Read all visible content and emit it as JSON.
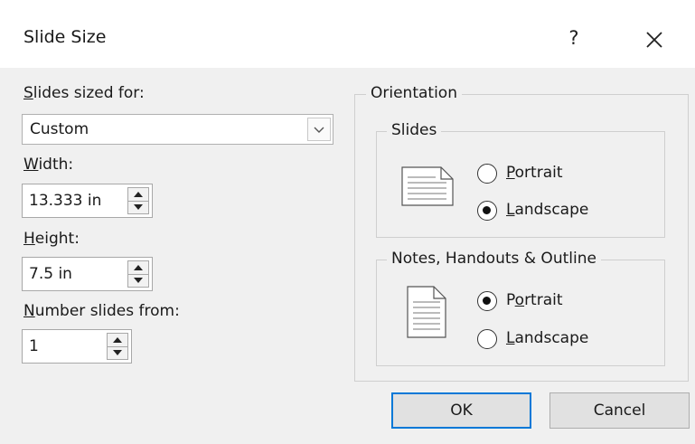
{
  "dialog": {
    "title": "Slide Size",
    "help": "?",
    "close_icon": "close-icon"
  },
  "left": {
    "sized_for_pre": "S",
    "sized_for_rest": "lides sized for:",
    "sized_for_value": "Custom",
    "width_pre": "W",
    "width_rest": "idth:",
    "width_value": "13.333 in",
    "height_pre": "H",
    "height_rest": "eight:",
    "height_value": "7.5 in",
    "number_pre": "N",
    "number_rest": "umber slides from:",
    "number_value": "1"
  },
  "orientation": {
    "title": "Orientation",
    "slides": {
      "title": "Slides",
      "portrait_pre": "",
      "portrait_ul": "P",
      "portrait_post": "ortrait",
      "landscape_pre": "",
      "landscape_ul": "L",
      "landscape_post": "andscape",
      "selected": "Landscape"
    },
    "notes": {
      "title": "Notes, Handouts & Outline",
      "portrait_pre": "P",
      "portrait_ul": "o",
      "portrait_post": "rtrait",
      "landscape_pre": "",
      "landscape_ul": "L",
      "landscape_post": "andscape",
      "selected": "Portrait"
    }
  },
  "buttons": {
    "ok": "OK",
    "cancel": "Cancel"
  },
  "colors": {
    "accent": "#0078d7",
    "dialog_bg": "#f0f0f0"
  }
}
